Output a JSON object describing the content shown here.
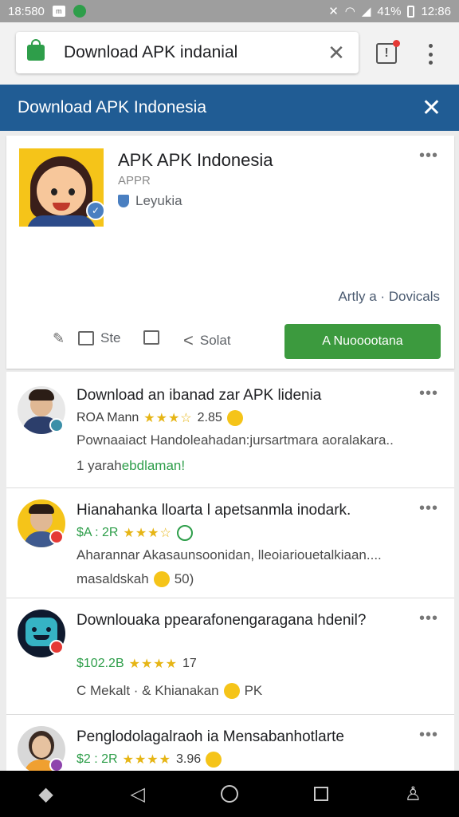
{
  "status_bar": {
    "time": "18:580",
    "box_icon_text": "m",
    "battery_percent": "41%",
    "right_time": "12:86"
  },
  "browser": {
    "url_text": "Download APK indanial",
    "tab_count": "!"
  },
  "banner": {
    "title": "Download APK Indonesia"
  },
  "app_card": {
    "title": "APK APK Indonesia",
    "subtitle": "APPR",
    "developer": "Leyukia",
    "activity": "Artly a · Dovicals",
    "actions": {
      "like_label": "Ste",
      "share_label": "Solat"
    },
    "install_label": "A Nuooootana"
  },
  "list_items": [
    {
      "title": "Download an ibanad zar APK lidenia",
      "meta_prefix": "ROA Mann",
      "stars": "★★★☆",
      "meta_suffix": "2.85",
      "desc": "Pownaaiact Handoleahadan:jursartmara aoralakara..",
      "foot_prefix": "1 yarah",
      "foot_green": "ebdlaman!"
    },
    {
      "title": "Hianahanka lloarta l apetsanmla inodark.",
      "meta_prefix": "$A : 2R",
      "stars": "★★★☆",
      "meta_suffix": "",
      "desc": "Aharannar Akasaunsoonidan, lleoiariouetalkiaan....",
      "foot_prefix": "masaldskah",
      "foot_suffix": "50)"
    },
    {
      "title": "Downlouaka ppearafonengaragana hdenil?",
      "meta_prefix": "$102.2B",
      "stars": "★★★★",
      "meta_suffix": "17",
      "desc": "",
      "foot_prefix": "C Mekalt · & Khianakan",
      "foot_suffix": "PK"
    },
    {
      "title": "Penglodolagalraoh ia Mensabanhotlarte",
      "meta_prefix": "$2 : 2R",
      "stars": "★★★★",
      "meta_suffix": "3.96"
    }
  ],
  "colors": {
    "banner": "#205c94",
    "install": "#3c9a3e",
    "star": "#e6b515"
  },
  "icons": {
    "lock": "lock-icon",
    "clear": "close-icon",
    "back": "back-icon",
    "home": "home-icon",
    "recents": "recents-icon",
    "person": "person-icon"
  }
}
